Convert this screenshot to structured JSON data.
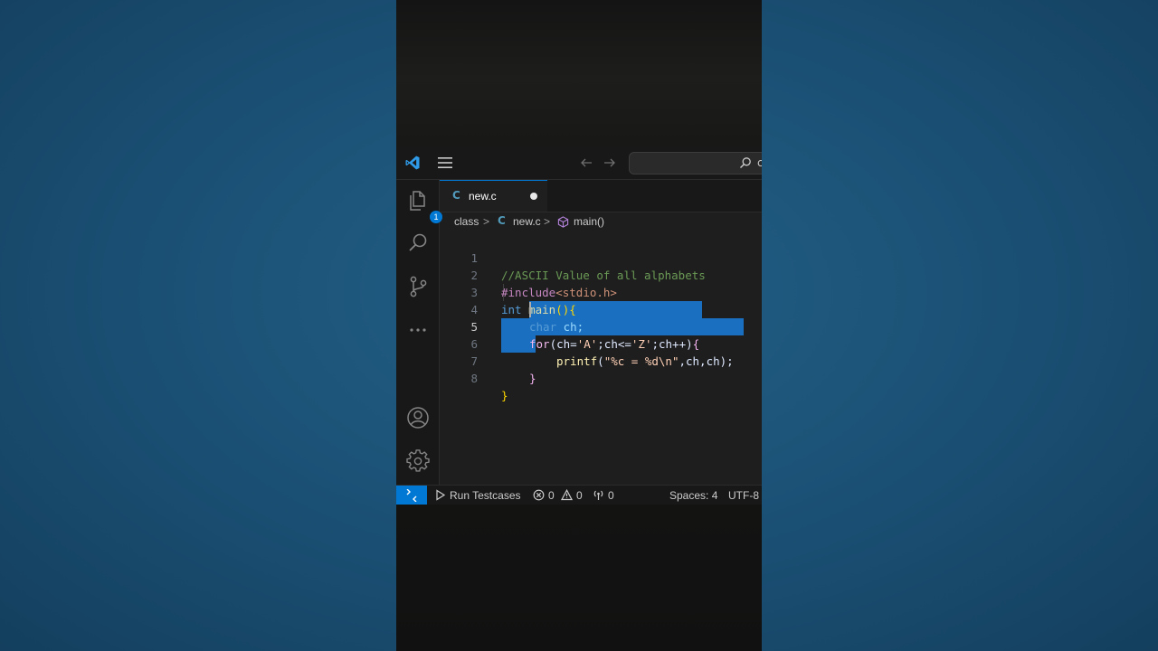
{
  "tab": {
    "label": "new.c",
    "file_icon": "C"
  },
  "breadcrumb": {
    "folder": "class",
    "file": "new.c",
    "file_icon": "C",
    "symbol": "main()",
    "separator": ">"
  },
  "explorer": {
    "badge": "1"
  },
  "search": {
    "placeholder": "c"
  },
  "editor": {
    "line_numbers": [
      "1",
      "2",
      "3",
      "4",
      "5",
      "6",
      "7",
      "8"
    ],
    "active_line": "5",
    "code": {
      "l1_comment": "//ASCII Value of all alphabets",
      "l2_directive": "#include",
      "l2_header": "<stdio.h>",
      "l3_type": "int",
      "l3_func": "main",
      "l3_parens": "()",
      "l3_brace": "{",
      "l4_type": "char",
      "l4_rest": " ch;",
      "l5_for": "for",
      "l5_a": "(ch=",
      "l5_s1": "'A'",
      "l5_b": ";ch<=",
      "l5_s2": "'Z'",
      "l5_c": ";ch++)",
      "l5_brace": "{",
      "l6_func": "printf",
      "l6_open": "(",
      "l6_str": "\"%c = %d\\n\"",
      "l6_rest": ",ch,ch);",
      "l7_brace": "}",
      "l8_brace": "}"
    }
  },
  "statusbar": {
    "run_label": "Run Testcases",
    "errors": "0",
    "warnings": "0",
    "ports": "0",
    "spaces": "Spaces: 4",
    "encoding": "UTF-8"
  },
  "colors": {
    "accent": "#0078d4",
    "selection": "#1a6fc0",
    "editor_bg": "#1e1e1e"
  },
  "icons": [
    "vscode-logo",
    "menu-icon",
    "arrow-left-icon",
    "arrow-right-icon",
    "search-icon",
    "files-icon",
    "search-icon",
    "source-control-icon",
    "ellipsis-icon",
    "account-icon",
    "gear-icon",
    "remote-icon",
    "play-icon",
    "error-icon",
    "warning-icon",
    "broadcast-icon",
    "symbol-method-icon"
  ]
}
